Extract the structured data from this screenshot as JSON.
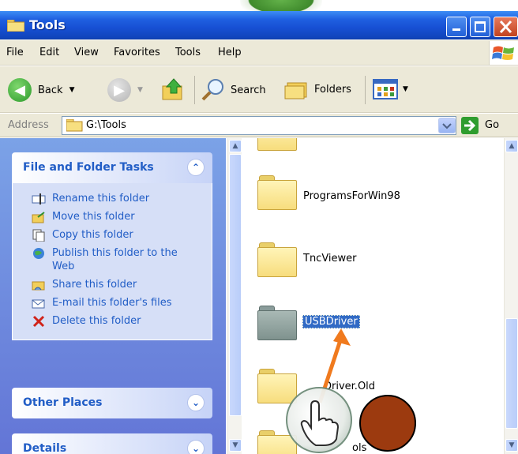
{
  "window": {
    "title": "Tools"
  },
  "menubar": {
    "items": [
      "File",
      "Edit",
      "View",
      "Favorites",
      "Tools",
      "Help"
    ]
  },
  "toolbar": {
    "back_label": "Back",
    "search_label": "Search",
    "folders_label": "Folders"
  },
  "address": {
    "label": "Address",
    "value": "G:\\Tools",
    "go_label": "Go"
  },
  "taskpane": {
    "file_folder_tasks": {
      "title": "File and Folder Tasks",
      "items": [
        {
          "label": "Rename this folder",
          "icon": "rename-icon"
        },
        {
          "label": "Move this folder",
          "icon": "move-icon"
        },
        {
          "label": "Copy this folder",
          "icon": "copy-icon"
        },
        {
          "label": "Publish this folder to the Web",
          "icon": "publish-icon"
        },
        {
          "label": "Share this folder",
          "icon": "share-icon"
        },
        {
          "label": "E-mail this folder's files",
          "icon": "email-icon"
        },
        {
          "label": "Delete this folder",
          "icon": "delete-icon"
        }
      ]
    },
    "other_places": {
      "title": "Other Places"
    },
    "details": {
      "title": "Details"
    }
  },
  "folders": [
    {
      "name": "",
      "style": "yellow"
    },
    {
      "name": "ProgramsForWin98",
      "style": "yellow"
    },
    {
      "name": "TncViewer",
      "style": "yellow"
    },
    {
      "name": "USBDriver",
      "style": "grey",
      "selected": true
    },
    {
      "name": "Driver.Old",
      "style": "yellow"
    },
    {
      "name": "ols",
      "style": "yellow"
    }
  ],
  "colors": {
    "titlebar": "#1f60e0",
    "taskpane": "#6d8fe0",
    "selection": "#316ac5",
    "arrow": "#f07a1e",
    "dot": "#9c3a0f"
  }
}
